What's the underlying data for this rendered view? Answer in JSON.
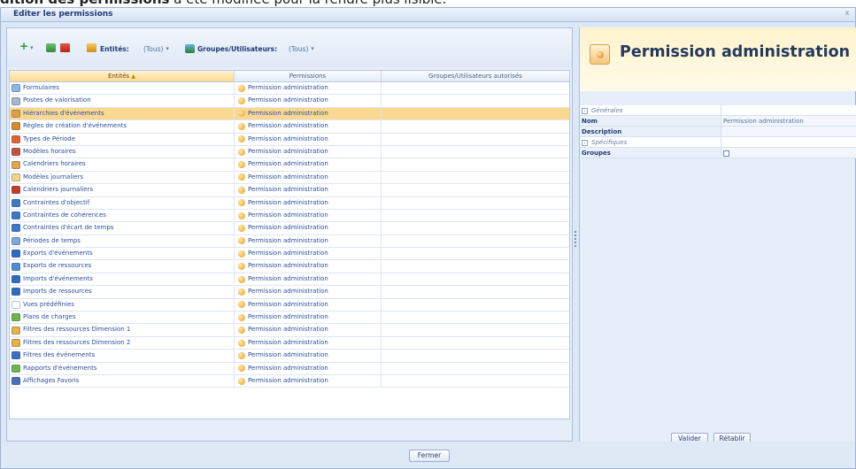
{
  "caption": {
    "bold": "dition des permissions",
    "rest": " a été modifiée pour la rendre plus lisible."
  },
  "window": {
    "title": "Editer les permissions",
    "close_glyph": "x"
  },
  "toolbar": {
    "add_glyph": "+",
    "dropdown_glyph": "▾",
    "entities_label": "Entités:",
    "entities_value": "(Tous)",
    "groups_label": "Groupes/Utilisateurs:",
    "groups_value": "(Tous)"
  },
  "grid": {
    "columns": [
      "Entités",
      "Permissions",
      "Groupes/Utilisateurs autorisés"
    ],
    "sort_indicator": "▲",
    "rows": [
      {
        "entity": "Formulaires",
        "permission": "Permission administration",
        "groups": "",
        "icon_color": "#8bb6e6"
      },
      {
        "entity": "Postes de valorisation",
        "permission": "Permission administration",
        "groups": "",
        "icon_color": "#a7b7cc"
      },
      {
        "entity": "Hiérarchies d'événements",
        "permission": "Permission administration",
        "groups": "",
        "icon_color": "#e0a040",
        "selected": true
      },
      {
        "entity": "Règles de création d'événements",
        "permission": "Permission administration",
        "groups": "",
        "icon_color": "#d58b2e"
      },
      {
        "entity": "Types de Période",
        "permission": "Permission administration",
        "groups": "",
        "icon_color": "#e2612f"
      },
      {
        "entity": "Modèles horaires",
        "permission": "Permission administration",
        "groups": "",
        "icon_color": "#c2543c"
      },
      {
        "entity": "Calendriers horaires",
        "permission": "Permission administration",
        "groups": "",
        "icon_color": "#e3a34b"
      },
      {
        "entity": "Modèles journaliers",
        "permission": "Permission administration",
        "groups": "",
        "icon_color": "#f1d58a"
      },
      {
        "entity": "Calendriers journaliers",
        "permission": "Permission administration",
        "groups": "",
        "icon_color": "#c63b2c"
      },
      {
        "entity": "Contraintes d'objectif",
        "permission": "Permission administration",
        "groups": "",
        "icon_color": "#3c78c4"
      },
      {
        "entity": "Contraintes de cohérences",
        "permission": "Permission administration",
        "groups": "",
        "icon_color": "#3c78c4"
      },
      {
        "entity": "Contraintes d'écart de temps",
        "permission": "Permission administration",
        "groups": "",
        "icon_color": "#3c78c4"
      },
      {
        "entity": "Périodes de temps",
        "permission": "Permission administration",
        "groups": "",
        "icon_color": "#7fa7d9"
      },
      {
        "entity": "Exports d'événements",
        "permission": "Permission administration",
        "groups": "",
        "icon_color": "#2f6bbf"
      },
      {
        "entity": "Exports de ressources",
        "permission": "Permission administration",
        "groups": "",
        "icon_color": "#4b8fd1"
      },
      {
        "entity": "Imports d'événements",
        "permission": "Permission administration",
        "groups": "",
        "icon_color": "#2f6bbf"
      },
      {
        "entity": "Imports de ressources",
        "permission": "Permission administration",
        "groups": "",
        "icon_color": "#2f6bbf"
      },
      {
        "entity": "Vues prédéfinies",
        "permission": "Permission administration",
        "groups": "",
        "icon_color": "#ffffff"
      },
      {
        "entity": "Plans de charges",
        "permission": "Permission administration",
        "groups": "",
        "icon_color": "#6fb54a"
      },
      {
        "entity": "Filtres des ressources Dimension 1",
        "permission": "Permission administration",
        "groups": "",
        "icon_color": "#e3b24b"
      },
      {
        "entity": "Filtres des ressources Dimension 2",
        "permission": "Permission administration",
        "groups": "",
        "icon_color": "#e3b24b"
      },
      {
        "entity": "Filtres des événements",
        "permission": "Permission administration",
        "groups": "",
        "icon_color": "#3c6fbf"
      },
      {
        "entity": "Rapports d'événements",
        "permission": "Permission administration",
        "groups": "",
        "icon_color": "#6fb54a"
      },
      {
        "entity": "Affichages Favoris",
        "permission": "Permission administration",
        "groups": "",
        "icon_color": "#4d6fb8"
      }
    ]
  },
  "footer": {
    "close_label": "Fermer"
  },
  "details": {
    "title": "Permission administration",
    "properties": [
      {
        "kind": "cat",
        "key": "Générales",
        "value": "",
        "expander": "-"
      },
      {
        "kind": "field",
        "key": "Nom",
        "value": "Permission administration"
      },
      {
        "kind": "field",
        "key": "Description",
        "value": ""
      },
      {
        "kind": "cat",
        "key": "Spécifiques",
        "value": "",
        "expander": "-"
      },
      {
        "kind": "field",
        "key": "Groupes",
        "value": "",
        "checkbox": true
      }
    ],
    "validate_label": "Valider",
    "reset_label": "Rétablir"
  },
  "colors": {
    "selected_row": "#fbd891",
    "header_bg": "#fff3cc",
    "window_bg": "#dde8f6"
  }
}
